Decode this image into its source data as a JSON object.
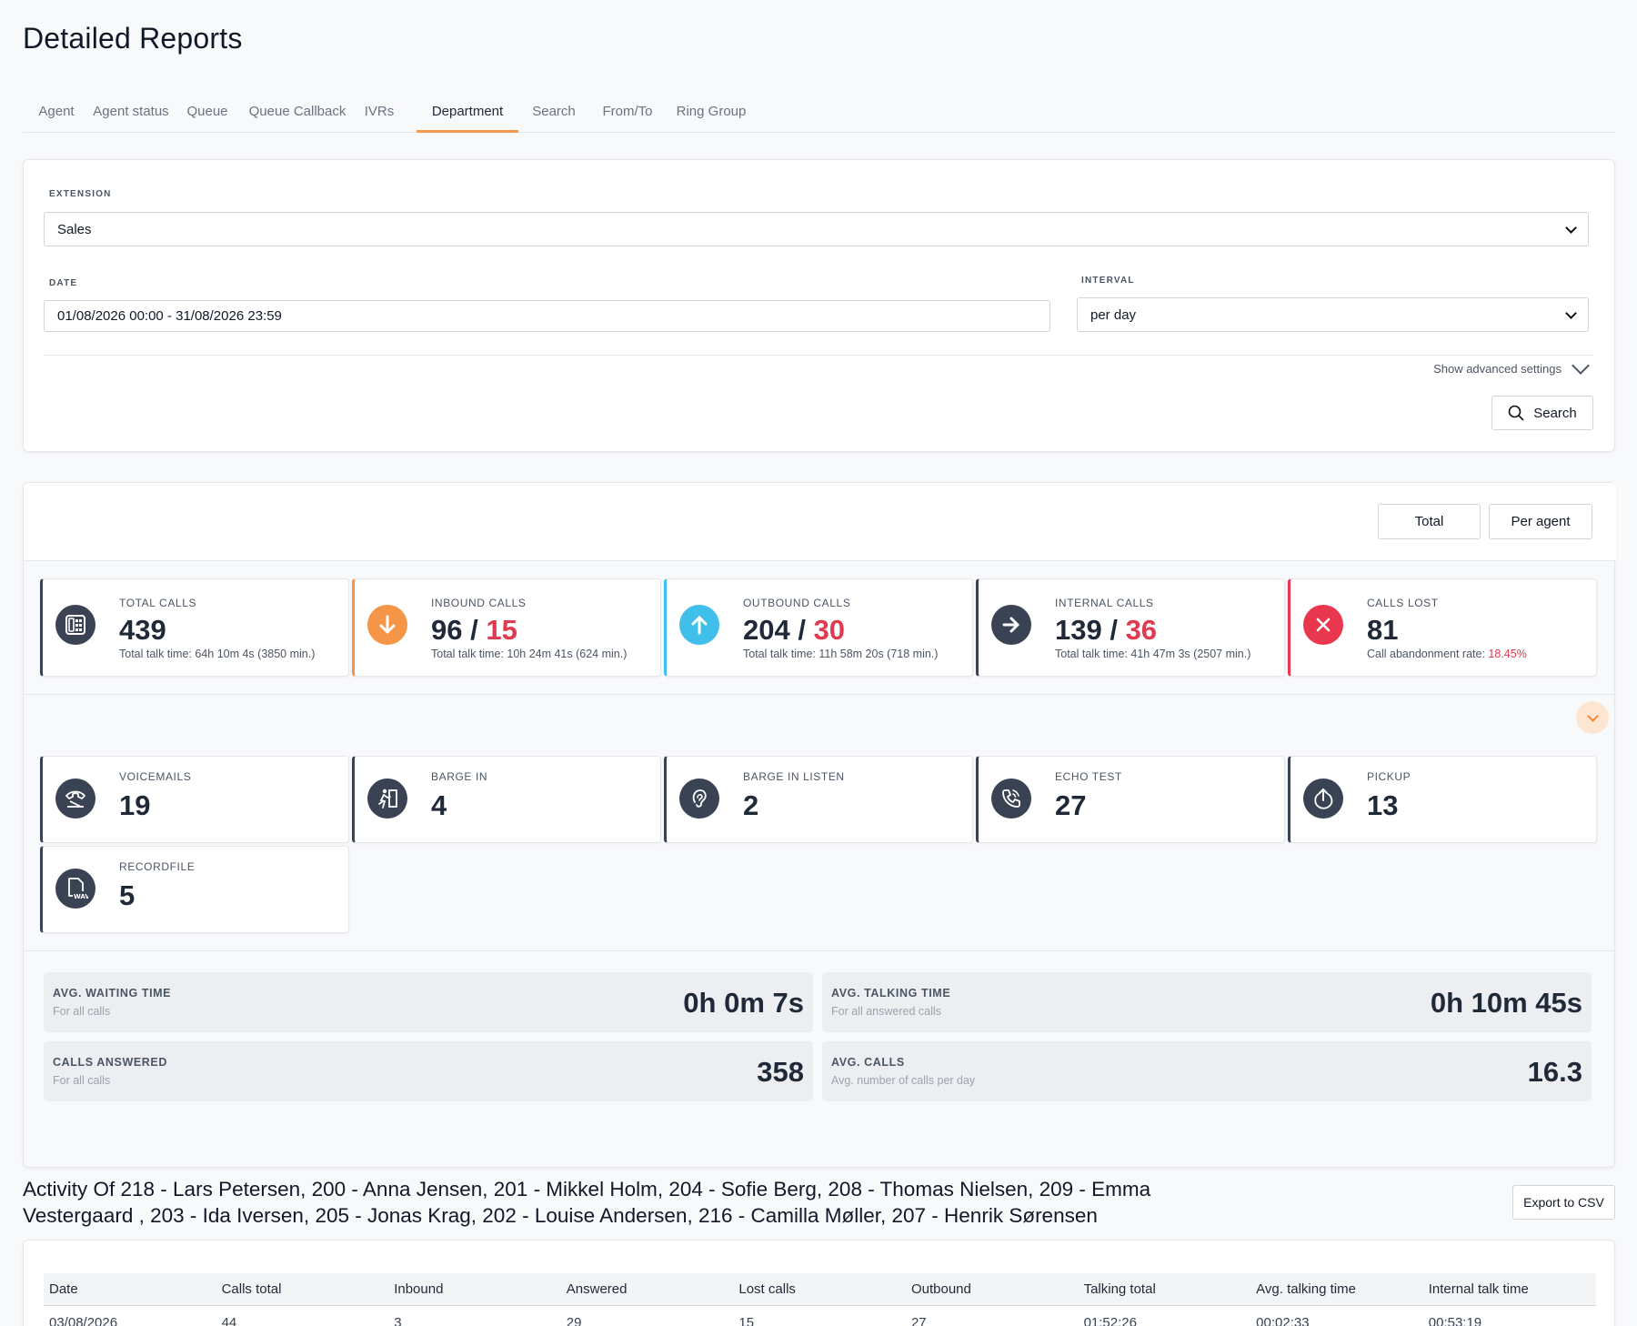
{
  "page_title": "Detailed Reports",
  "tabs": [
    {
      "label": "Agent"
    },
    {
      "label": "Agent status"
    },
    {
      "label": "Queue"
    },
    {
      "label": "Queue Callback"
    },
    {
      "label": "IVRs"
    },
    {
      "label": "Department",
      "active": true
    },
    {
      "label": "Search"
    },
    {
      "label": "From/To"
    },
    {
      "label": "Ring Group"
    }
  ],
  "filters": {
    "extension_label": "EXTENSION",
    "extension_value": "Sales",
    "date_label": "DATE",
    "date_value": "01/08/2026 00:00 - 31/08/2026 23:59",
    "interval_label": "INTERVAL",
    "interval_value": "per day",
    "advanced_label": "Show advanced settings",
    "search_button": "Search"
  },
  "view_toggle": {
    "total": "Total",
    "per_agent": "Per agent"
  },
  "stats_primary": [
    {
      "label": "TOTAL CALLS",
      "value": "439",
      "value_red": "",
      "sub": "Total talk time: 64h 10m 4s (3850 min.)",
      "icon": "fax-phone-icon",
      "color": "#3a4354"
    },
    {
      "label": "INBOUND CALLS",
      "value": "96 / ",
      "value_red": "15",
      "sub": "Total talk time: 10h 24m 41s (624 min.)",
      "icon": "arrow-down-icon",
      "color": "#f59547"
    },
    {
      "label": "OUTBOUND CALLS",
      "value": "204 / ",
      "value_red": "30",
      "sub": "Total talk time: 11h 58m 20s (718 min.)",
      "icon": "arrow-up-icon",
      "color": "#3fbfea"
    },
    {
      "label": "INTERNAL CALLS",
      "value": "139 / ",
      "value_red": "36",
      "sub": "Total talk time: 41h 47m 3s (2507 min.)",
      "icon": "arrow-right-icon",
      "color": "#3a4354"
    },
    {
      "label": "CALLS LOST",
      "value": "",
      "value_red": "81",
      "sub": "Call abandonment rate: ",
      "sub_red": "18.45%",
      "icon": "x-icon",
      "color": "#e9374e"
    }
  ],
  "stats_secondary": [
    {
      "label": "VOICEMAILS",
      "value": "19",
      "icon": "voicemail-phone-icon"
    },
    {
      "label": "BARGE IN",
      "value": "4",
      "icon": "barge-in-icon"
    },
    {
      "label": "BARGE IN LISTEN",
      "value": "2",
      "icon": "ear-icon"
    },
    {
      "label": "ECHO TEST",
      "value": "27",
      "icon": "phone-echo-icon"
    },
    {
      "label": "PICKUP",
      "value": "13",
      "icon": "pickup-icon"
    },
    {
      "label": "RECORDFILE",
      "value": "5",
      "icon": "wav-file-icon"
    }
  ],
  "averages": [
    {
      "title": "AVG. WAITING TIME",
      "subtitle": "For all calls",
      "value": "0h 0m 7s"
    },
    {
      "title": "AVG. TALKING TIME",
      "subtitle": "For all answered calls",
      "value": "0h 10m 45s"
    },
    {
      "title": "CALLS ANSWERED",
      "subtitle": "For all calls",
      "value": "358"
    },
    {
      "title": "AVG. CALLS",
      "subtitle": "Avg. number of calls per day",
      "value": "16.3"
    }
  ],
  "activity": {
    "title": "Activity Of 218 - Lars Petersen, 200 - Anna Jensen, 201 - Mikkel Holm, 204 - Sofie Berg, 208 - Thomas Nielsen, 209 - Emma Vestergaard , 203 - Ida Iversen, 205 - Jonas Krag, 202 - Louise Andersen, 216 - Camilla Møller, 207 - Henrik Sørensen",
    "export_button": "Export to CSV"
  },
  "table": {
    "columns": [
      "Date",
      "Calls total",
      "Inbound",
      "Answered",
      "Lost calls",
      "Outbound",
      "Talking total",
      "Avg. talking time",
      "Internal talk time"
    ],
    "rows": [
      [
        "03/08/2026",
        "44",
        "3",
        "29",
        "15",
        "27",
        "01:52:26",
        "00:02:33",
        "00:53:19"
      ]
    ]
  }
}
